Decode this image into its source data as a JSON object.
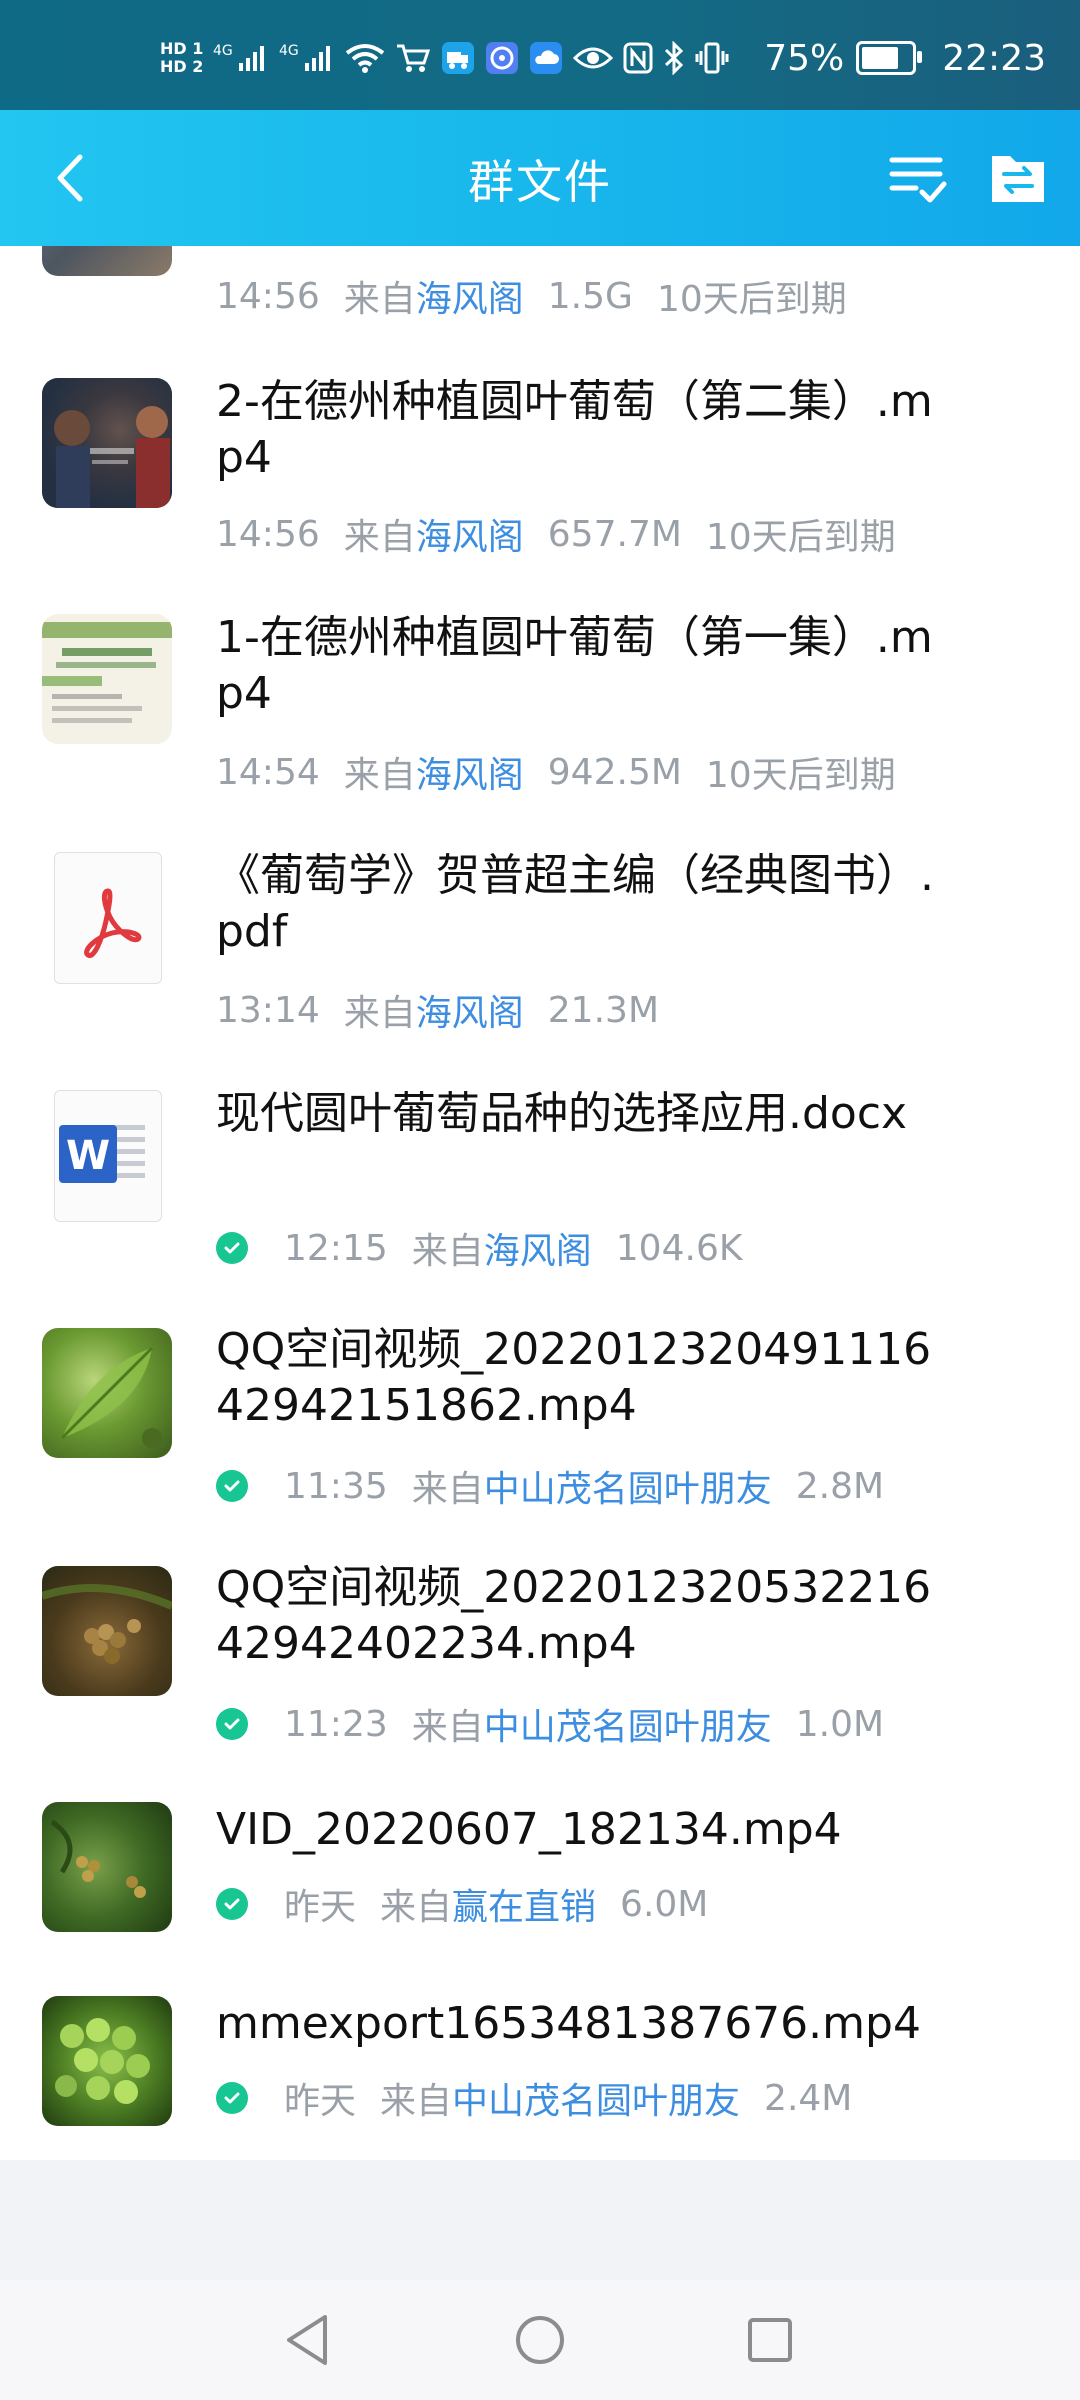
{
  "status_bar": {
    "hd1": "HD 1",
    "hd2": "HD 2",
    "net1": "4G",
    "net2": "4G",
    "battery_percent": "75%",
    "battery_level": 0.75,
    "time": "22:23"
  },
  "header": {
    "title": "群文件"
  },
  "files": [
    {
      "name": "",
      "time": "14:56",
      "from_prefix": "来自",
      "from": "海风阁",
      "size": "1.5G",
      "expire": "10天后到期",
      "downloaded": false
    },
    {
      "name": "2-在德州种植圆叶葡萄（第二集）.mp4",
      "time": "14:56",
      "from_prefix": "来自",
      "from": "海风阁",
      "size": "657.7M",
      "expire": "10天后到期",
      "downloaded": false
    },
    {
      "name": "1-在德州种植圆叶葡萄（第一集）.mp4",
      "time": "14:54",
      "from_prefix": "来自",
      "from": "海风阁",
      "size": "942.5M",
      "expire": "10天后到期",
      "downloaded": false
    },
    {
      "name": "《葡萄学》贺普超主编（经典图书）.pdf",
      "time": "13:14",
      "from_prefix": "来自",
      "from": "海风阁",
      "size": "21.3M",
      "expire": "",
      "downloaded": false
    },
    {
      "name": "现代圆叶葡萄品种的选择应用.docx",
      "time": "12:15",
      "from_prefix": "来自",
      "from": "海风阁",
      "size": "104.6K",
      "expire": "",
      "downloaded": true
    },
    {
      "name": "QQ空间视频_2022012320491116 42942151862.mp4",
      "time": "11:35",
      "from_prefix": "来自",
      "from": "中山茂名圆叶朋友",
      "size": "2.8M",
      "expire": "",
      "downloaded": true
    },
    {
      "name": "QQ空间视频_2022012320532216 42942402234.mp4",
      "time": "11:23",
      "from_prefix": "来自",
      "from": "中山茂名圆叶朋友",
      "size": "1.0M",
      "expire": "",
      "downloaded": true
    },
    {
      "name": "VID_20220607_182134.mp4",
      "time": "昨天",
      "from_prefix": "来自",
      "from": "赢在直销",
      "size": "6.0M",
      "expire": "",
      "downloaded": true
    },
    {
      "name": "mmexport1653481387676.mp4",
      "time": "昨天",
      "from_prefix": "来自",
      "from": "中山茂名圆叶朋友",
      "size": "2.4M",
      "expire": "",
      "downloaded": true
    }
  ],
  "colors": {
    "accent": "#1db9ee",
    "link": "#3d8ee0",
    "check": "#18c693",
    "meta_text": "#9aa0a8"
  }
}
